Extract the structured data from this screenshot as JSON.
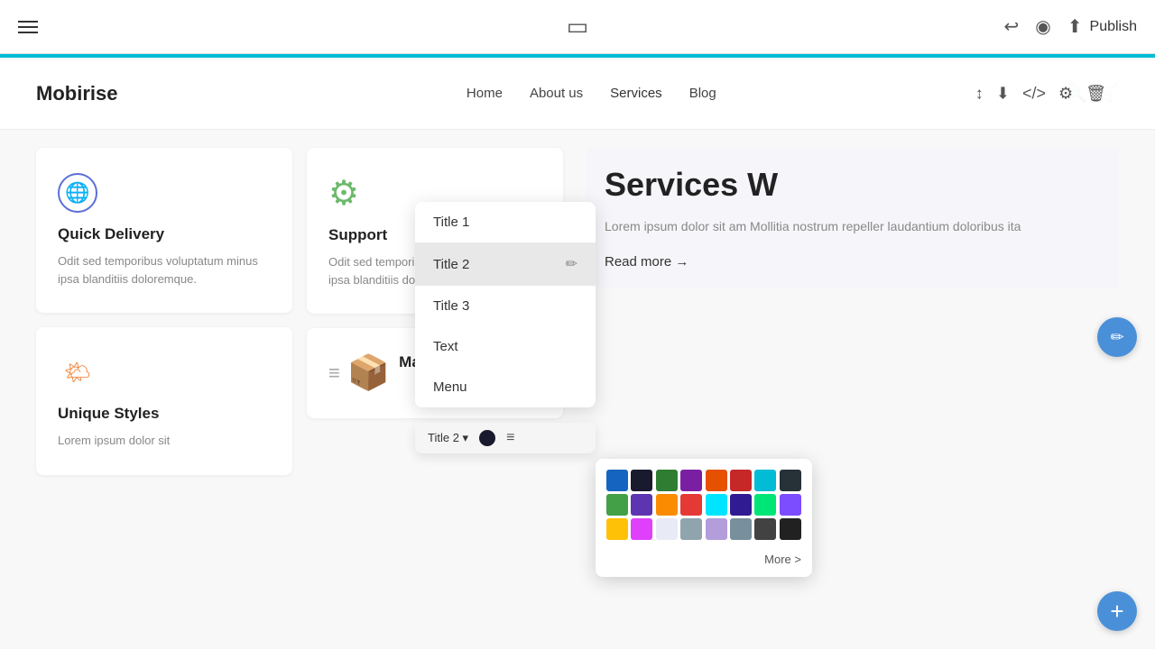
{
  "toolbar": {
    "hamburger_label": "menu",
    "publish_label": "Publish",
    "back_icon": "↩",
    "eye_icon": "👁",
    "upload_icon": "⬆"
  },
  "nav": {
    "logo": "Mobirise",
    "links": [
      "Home",
      "About us",
      "Services",
      "Blog"
    ]
  },
  "block_tools": {
    "move_up": "↕",
    "download": "⬇",
    "code": "</>",
    "settings": "⚙",
    "delete": "🗑"
  },
  "cards": [
    {
      "icon_type": "globe",
      "title": "Quick Delivery",
      "text": "Odit sed temporibus voluptatum minus ipsa blanditiis doloremque."
    },
    {
      "icon_type": "sun",
      "title": "Unique Styles",
      "text": "Lorem ipsum dolor sit"
    }
  ],
  "mid_cards": [
    {
      "icon_type": "gear",
      "title": "Support",
      "text": "Odit sed temporibus voluptatum minus ipsa blanditiis doloremque."
    },
    {
      "icon_type": "bag",
      "title": "Market",
      "text": ""
    }
  ],
  "services_section": {
    "title": "Services W",
    "text": "Lorem ipsum dolor sit am Mollitia nostrum repeller laudantium doloribus ita",
    "read_more": "Read more →"
  },
  "dropdown": {
    "items": [
      "Title 1",
      "Title 2",
      "Title 3",
      "Text",
      "Menu"
    ],
    "selected": "Title 2",
    "current_label": "Title 2 ▾"
  },
  "color_swatches": [
    "#1565c0",
    "#1a1a2e",
    "#2e7d32",
    "#7b1fa2",
    "#e65100",
    "#c62828",
    "#00bcd4",
    "#263238",
    "#43a047",
    "#5e35b1",
    "#fb8c00",
    "#e53935",
    "#00e5ff",
    "#311b92",
    "#00e676",
    "#7c4dff",
    "#ffc107",
    "#e040fb",
    "#e8eaf6",
    "#90a4ae",
    "#b39ddb",
    "#78909c",
    "#424242",
    "#212121"
  ],
  "more_label": "More >",
  "format_bar": {
    "style_label": "Title 2 ▾"
  }
}
